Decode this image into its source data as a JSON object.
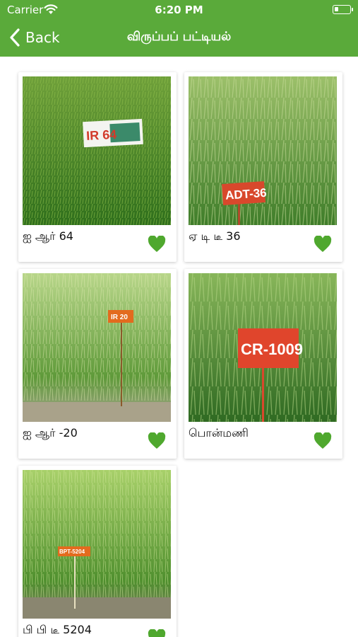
{
  "status_bar": {
    "carrier": "Carrier",
    "time": "6:20 PM"
  },
  "nav": {
    "back_label": "Back",
    "title": "விருப்பப் பட்டியல்"
  },
  "colors": {
    "header": "#5aaa3a",
    "heart": "#4fa82e"
  },
  "items": [
    {
      "name": "ஐ ஆர் 64",
      "sign": "IR 64",
      "favorited": true
    },
    {
      "name": "ஏ டி டீ 36",
      "sign": "ADT-36",
      "favorited": true
    },
    {
      "name": "ஐ ஆர் -20",
      "sign": "IR 20",
      "favorited": true
    },
    {
      "name": "பொன்மணி",
      "sign": "CR-1009",
      "favorited": true
    },
    {
      "name": "பி பி டீ 5204",
      "sign": "BPT-5204",
      "favorited": true
    }
  ]
}
